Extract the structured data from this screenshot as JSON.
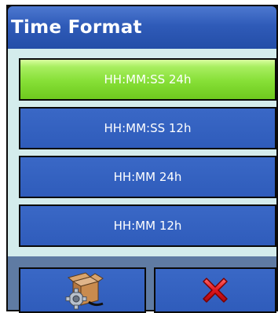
{
  "dialog": {
    "title": "Time Format"
  },
  "options": [
    {
      "label": "HH:MM:SS 24h",
      "selected": true
    },
    {
      "label": "HH:MM:SS 12h",
      "selected": false
    },
    {
      "label": "HH:MM 24h",
      "selected": false
    },
    {
      "label": "HH:MM 12h",
      "selected": false
    }
  ],
  "footer": {
    "left_icon": "settings-box-icon",
    "right_icon": "close-icon"
  },
  "colors": {
    "selected": "#86df36",
    "option": "#2f5cbb",
    "title_bar": "#2f5bb8",
    "panel": "#d4ecec",
    "footer": "#5f7ba3",
    "close": "#e0161d"
  }
}
